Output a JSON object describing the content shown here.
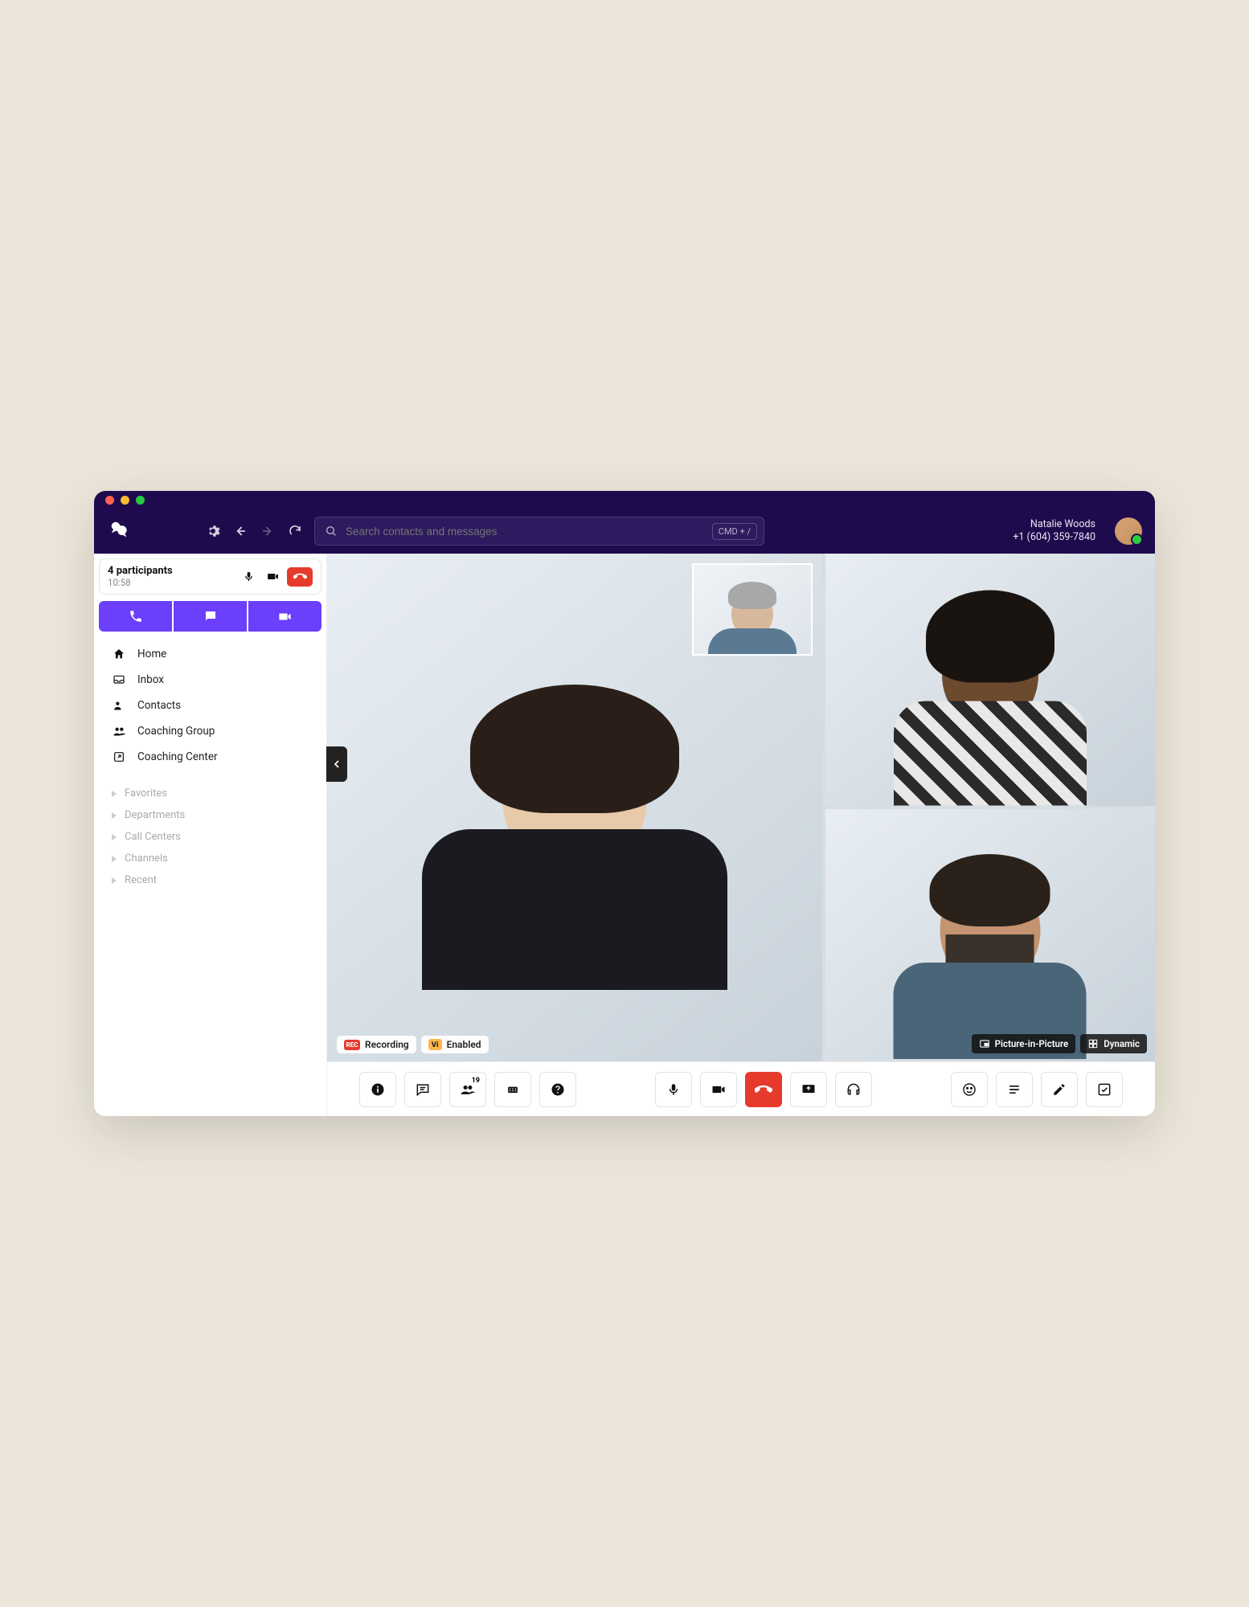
{
  "header": {
    "search_placeholder": "Search contacts and messages",
    "shortcut": "CMD + /",
    "user_name": "Natalie Woods",
    "user_phone": "+1 (604) 359-7840"
  },
  "call_card": {
    "title": "4 participants",
    "duration": "10:58"
  },
  "sidebar": {
    "nav": [
      {
        "icon": "home",
        "label": "Home"
      },
      {
        "icon": "inbox",
        "label": "Inbox"
      },
      {
        "icon": "contacts",
        "label": "Contacts"
      },
      {
        "icon": "group",
        "label": "Coaching Group"
      },
      {
        "icon": "center",
        "label": "Coaching Center"
      }
    ],
    "groups": [
      "Favorites",
      "Departments",
      "Call Centers",
      "Channels",
      "Recent"
    ]
  },
  "video": {
    "badge_record": "Recording",
    "badge_vi": "Enabled",
    "overlay_pip": "Picture-in-Picture",
    "overlay_dynamic": "Dynamic"
  },
  "toolbar": {
    "participants_count": "19"
  },
  "colors": {
    "header": "#1f0a4d",
    "accent": "#6b3ffb",
    "danger": "#e63a2d"
  }
}
